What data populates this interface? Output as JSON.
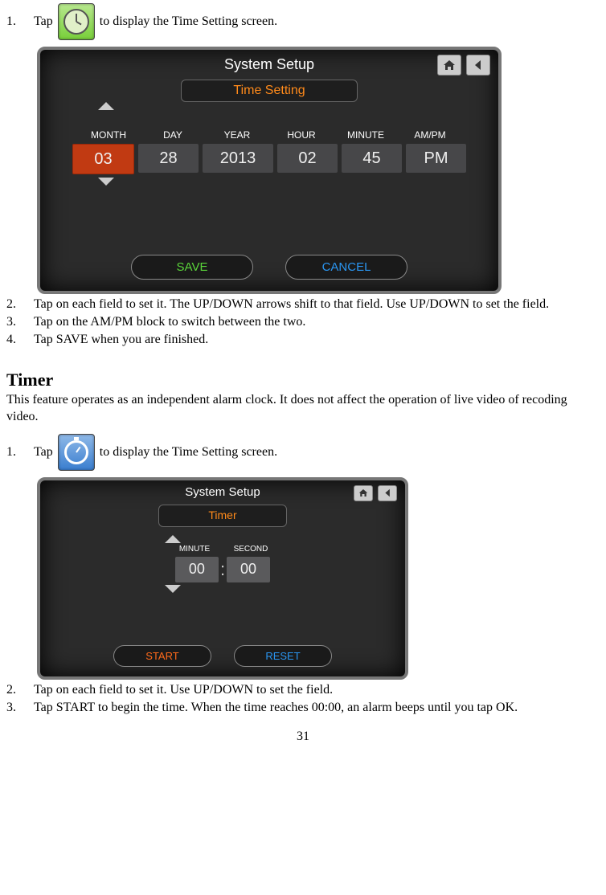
{
  "step1": {
    "num": "1.",
    "pre": "Tap",
    "post": " to display the Time Setting screen."
  },
  "panel1": {
    "title": "System Setup",
    "tab": "Time Setting",
    "labels": [
      "MONTH",
      "DAY",
      "YEAR",
      "HOUR",
      "MINUTE",
      "AM/PM"
    ],
    "values": [
      "03",
      "28",
      "2013",
      "02",
      "45",
      "PM"
    ],
    "save": "SAVE",
    "cancel": "CANCEL"
  },
  "step2": {
    "num": "2.",
    "text": "Tap on each field to set it. The UP/DOWN arrows shift to that field. Use UP/DOWN to set the field."
  },
  "step3": {
    "num": "3.",
    "text": "Tap on the AM/PM block to switch between the two."
  },
  "step4": {
    "num": "4.",
    "text": "Tap SAVE when you are finished."
  },
  "timerHeading": "Timer",
  "timerPara": "This feature operates as an independent alarm clock. It does not affect the operation of live video of recoding video.",
  "tstep1": {
    "num": "1.",
    "pre": "Tap",
    "post": " to display the Time Setting screen."
  },
  "panel2": {
    "title": "System Setup",
    "tab": "Timer",
    "labels": [
      "MINUTE",
      "SECOND"
    ],
    "values": [
      "00",
      "00"
    ],
    "start": "START",
    "reset": "RESET"
  },
  "tstep2": {
    "num": "2.",
    "text": "Tap on each field to set it. Use UP/DOWN to set the field."
  },
  "tstep3": {
    "num": "3.",
    "text": "Tap START to begin the time. When the time reaches 00:00, an alarm beeps until you tap OK."
  },
  "pageNum": "31"
}
